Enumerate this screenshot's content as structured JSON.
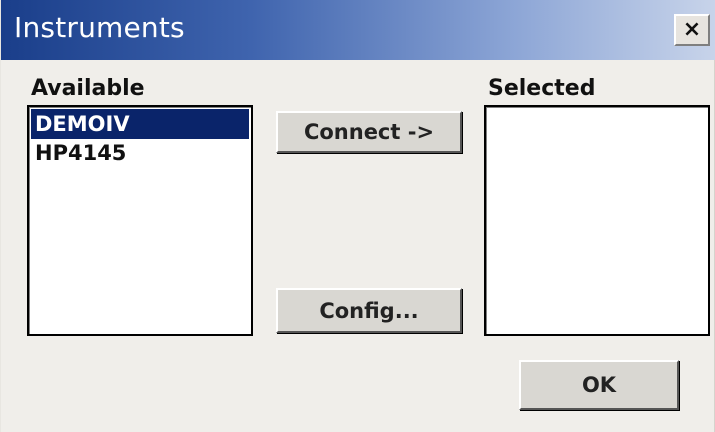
{
  "window": {
    "title": "Instruments",
    "close_glyph": "×",
    "titlebar_colors": [
      "#1a3e8a",
      "#c8d4ea"
    ]
  },
  "available": {
    "label": "Available",
    "items": [
      "DEMOIV",
      "HP4145"
    ],
    "selected_item": "DEMOIV"
  },
  "selected": {
    "label": "Selected",
    "items": []
  },
  "buttons": {
    "connect_label": "Connect ->",
    "config_label": "Config...",
    "ok_label": "OK"
  },
  "colors": {
    "selection_highlight": "#0a246a",
    "dialog_background": "#f0eeea"
  }
}
